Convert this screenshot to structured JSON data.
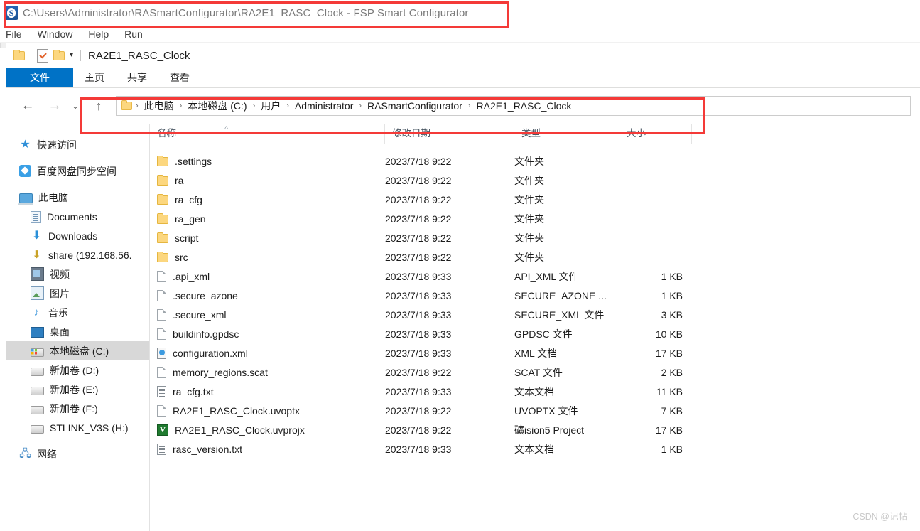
{
  "app": {
    "title": "C:\\Users\\Administrator\\RASmartConfigurator\\RA2E1_RASC_Clock - FSP Smart Configurator",
    "icon": "fsp-app-icon",
    "menu": [
      "File",
      "Window",
      "Help",
      "Run"
    ]
  },
  "explorer": {
    "quick_access": {
      "folder_icon": "folder-icon",
      "properties_icon": "properties-icon",
      "new_folder_icon": "new-folder-icon",
      "customize_caret": "▾",
      "window_title": "RA2E1_RASC_Clock"
    },
    "ribbon_tabs": [
      {
        "label": "文件",
        "active": true
      },
      {
        "label": "主页",
        "active": false
      },
      {
        "label": "共享",
        "active": false
      },
      {
        "label": "查看",
        "active": false
      }
    ],
    "nav_buttons": {
      "back": "←",
      "forward": "→",
      "recent": "⌄",
      "up": "↑"
    },
    "breadcrumb": {
      "icon": "folder-icon",
      "separator": "›",
      "items": [
        "此电脑",
        "本地磁盘 (C:)",
        "用户",
        "Administrator",
        "RASmartConfigurator",
        "RA2E1_RASC_Clock"
      ]
    },
    "sidebar": [
      {
        "label": "快速访问",
        "icon": "star-icon",
        "level": 0,
        "selected": false
      },
      {
        "label": "百度网盘同步空间",
        "icon": "baidu-netdisk-icon",
        "level": 0,
        "selected": false,
        "gap_before": true
      },
      {
        "label": "此电脑",
        "icon": "this-pc-icon",
        "level": 0,
        "selected": false,
        "gap_before": true
      },
      {
        "label": "Documents",
        "icon": "documents-icon",
        "level": 1,
        "selected": false
      },
      {
        "label": "Downloads",
        "icon": "downloads-icon",
        "level": 1,
        "selected": false
      },
      {
        "label": "share (192.168.56.",
        "icon": "network-share-icon",
        "level": 1,
        "selected": false
      },
      {
        "label": "视频",
        "icon": "videos-icon",
        "level": 1,
        "selected": false
      },
      {
        "label": "图片",
        "icon": "pictures-icon",
        "level": 1,
        "selected": false
      },
      {
        "label": "音乐",
        "icon": "music-icon",
        "level": 1,
        "selected": false
      },
      {
        "label": "桌面",
        "icon": "desktop-icon",
        "level": 1,
        "selected": false
      },
      {
        "label": "本地磁盘 (C:)",
        "icon": "system-drive-icon",
        "level": 1,
        "selected": true
      },
      {
        "label": "新加卷 (D:)",
        "icon": "drive-icon",
        "level": 1,
        "selected": false
      },
      {
        "label": "新加卷 (E:)",
        "icon": "drive-icon",
        "level": 1,
        "selected": false
      },
      {
        "label": "新加卷 (F:)",
        "icon": "drive-icon",
        "level": 1,
        "selected": false
      },
      {
        "label": "STLINK_V3S (H:)",
        "icon": "drive-icon",
        "level": 1,
        "selected": false
      },
      {
        "label": "网络",
        "icon": "network-icon",
        "level": 0,
        "selected": false,
        "gap_before": true
      }
    ],
    "columns": {
      "name": "名称",
      "date": "修改日期",
      "type": "类型",
      "size": "大小",
      "sort_indicator": "^"
    },
    "files": [
      {
        "name": ".settings",
        "date": "2023/7/18 9:22",
        "type": "文件夹",
        "size": "",
        "icon": "folder-icon"
      },
      {
        "name": "ra",
        "date": "2023/7/18 9:22",
        "type": "文件夹",
        "size": "",
        "icon": "folder-icon"
      },
      {
        "name": "ra_cfg",
        "date": "2023/7/18 9:22",
        "type": "文件夹",
        "size": "",
        "icon": "folder-icon"
      },
      {
        "name": "ra_gen",
        "date": "2023/7/18 9:22",
        "type": "文件夹",
        "size": "",
        "icon": "folder-icon"
      },
      {
        "name": "script",
        "date": "2023/7/18 9:22",
        "type": "文件夹",
        "size": "",
        "icon": "folder-icon"
      },
      {
        "name": "src",
        "date": "2023/7/18 9:22",
        "type": "文件夹",
        "size": "",
        "icon": "folder-icon"
      },
      {
        "name": ".api_xml",
        "date": "2023/7/18 9:33",
        "type": "API_XML 文件",
        "size": "1 KB",
        "icon": "blank-file-icon"
      },
      {
        "name": ".secure_azone",
        "date": "2023/7/18 9:33",
        "type": "SECURE_AZONE ...",
        "size": "1 KB",
        "icon": "blank-file-icon"
      },
      {
        "name": ".secure_xml",
        "date": "2023/7/18 9:33",
        "type": "SECURE_XML 文件",
        "size": "3 KB",
        "icon": "blank-file-icon"
      },
      {
        "name": "buildinfo.gpdsc",
        "date": "2023/7/18 9:33",
        "type": "GPDSC 文件",
        "size": "10 KB",
        "icon": "blank-file-icon"
      },
      {
        "name": "configuration.xml",
        "date": "2023/7/18 9:33",
        "type": "XML 文档",
        "size": "17 KB",
        "icon": "xml-file-icon"
      },
      {
        "name": "memory_regions.scat",
        "date": "2023/7/18 9:22",
        "type": "SCAT 文件",
        "size": "2 KB",
        "icon": "blank-file-icon"
      },
      {
        "name": "ra_cfg.txt",
        "date": "2023/7/18 9:33",
        "type": "文本文档",
        "size": "11 KB",
        "icon": "text-file-icon"
      },
      {
        "name": "RA2E1_RASC_Clock.uvoptx",
        "date": "2023/7/18 9:22",
        "type": "UVOPTX 文件",
        "size": "7 KB",
        "icon": "blank-file-icon"
      },
      {
        "name": "RA2E1_RASC_Clock.uvprojx",
        "date": "2023/7/18 9:22",
        "type": "礦ision5 Project",
        "size": "17 KB",
        "icon": "uvision-file-icon"
      },
      {
        "name": "rasc_version.txt",
        "date": "2023/7/18 9:33",
        "type": "文本文档",
        "size": "1 KB",
        "icon": "text-file-icon"
      }
    ]
  },
  "watermark": "CSDN @记帖",
  "colors": {
    "file_tab_blue": "#0072c6",
    "annotation_red": "#f43a38",
    "selection_gray": "#d8d8d8",
    "folder_yellow": "#fcd77f"
  }
}
